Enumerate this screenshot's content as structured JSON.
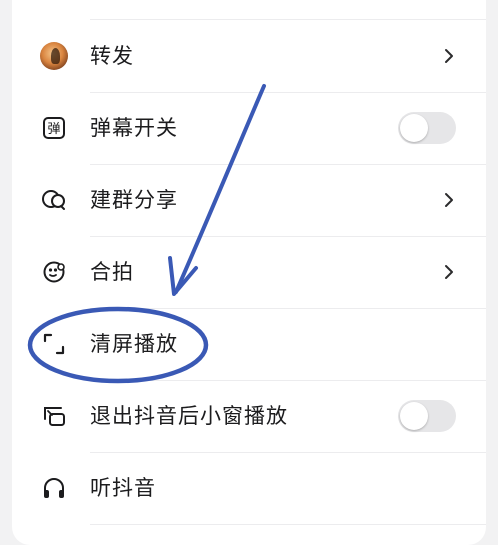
{
  "menu": {
    "items": [
      {
        "id": "forward",
        "label": "转发",
        "icon": "avatar-icon",
        "control": "chevron"
      },
      {
        "id": "danmaku",
        "label": "弹幕开关",
        "icon": "danmaku-icon",
        "control": "toggle",
        "toggle_on": false
      },
      {
        "id": "group-share",
        "label": "建群分享",
        "icon": "group-chat-icon",
        "control": "chevron"
      },
      {
        "id": "duet",
        "label": "合拍",
        "icon": "duet-icon",
        "control": "chevron"
      },
      {
        "id": "clear-screen",
        "label": "清屏播放",
        "icon": "clear-screen-icon",
        "control": "none"
      },
      {
        "id": "pip",
        "label": "退出抖音后小窗播放",
        "icon": "pip-icon",
        "control": "toggle",
        "toggle_on": false
      },
      {
        "id": "listen",
        "label": "听抖音",
        "icon": "headphones-icon",
        "control": "none"
      }
    ]
  },
  "annotation": {
    "color": "#3a59b5",
    "arrow_target": "清屏播放"
  },
  "colors": {
    "background": "#f2f2f3",
    "sheet": "#ffffff",
    "text": "#1c1c1e",
    "toggle_off": "#e6e6e8"
  }
}
